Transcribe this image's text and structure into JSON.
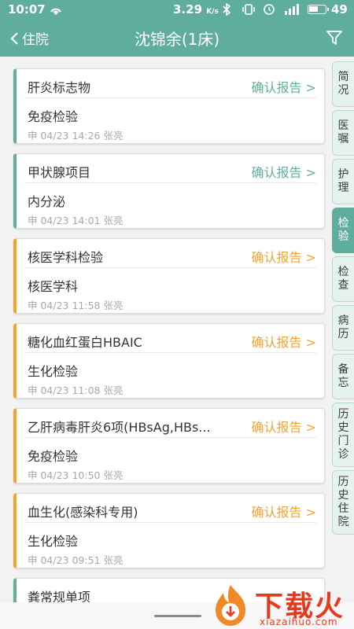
{
  "status_bar": {
    "time": "10:07",
    "net_speed": "3.29",
    "net_unit": "K/s",
    "battery": "49"
  },
  "nav": {
    "back_label": "住院",
    "title": "沈锦余(1床)"
  },
  "reports": [
    {
      "name": "肝炎标志物",
      "action": "确认报告 >",
      "category": "免疫检验",
      "meta": "申 04/23 14:26 张亮",
      "state": "green"
    },
    {
      "name": "甲状腺项目",
      "action": "确认报告 >",
      "category": "内分泌",
      "meta": "申 04/23 14:01 张亮",
      "state": "green"
    },
    {
      "name": "核医学科检验",
      "action": "确认报告 >",
      "category": "核医学科",
      "meta": "申 04/23 11:58 张亮",
      "state": "orange"
    },
    {
      "name": "糖化血红蛋白HBAIC",
      "action": "确认报告 >",
      "category": "生化检验",
      "meta": "申 04/23 11:08 张亮",
      "state": "orange"
    },
    {
      "name": "乙肝病毒肝炎6项(HBsAg,HBs...",
      "action": "确认报告 >",
      "category": "免疫检验",
      "meta": "申 04/23 10:50 张亮",
      "state": "orange"
    },
    {
      "name": "血生化(感染科专用)",
      "action": "确认报告 >",
      "category": "生化检验",
      "meta": "申 04/23 09:51 张亮",
      "state": "orange"
    },
    {
      "name": "粪常规单项",
      "action": "",
      "category": "",
      "meta": "",
      "state": "green"
    }
  ],
  "side_tabs": [
    "简况",
    "医嘱",
    "护理",
    "检验",
    "检查",
    "病历",
    "备忘",
    "历史门诊",
    "历史住院"
  ],
  "active_tab": "检验",
  "watermark": {
    "cn": "下载火",
    "en": "xiazaihuo.com"
  },
  "colors": {
    "primary": "#5fae9d",
    "pending": "#f0a430",
    "watermark": "#e8391d"
  },
  "icons": {
    "back": "chevron-left-icon",
    "filter": "filter-funnel-icon",
    "wifi": "hotspot-icon",
    "bluetooth": "bluetooth-icon",
    "vibrate": "vibrate-icon",
    "alarm": "alarm-icon",
    "signal": "signal-icon",
    "battery": "battery-icon"
  }
}
